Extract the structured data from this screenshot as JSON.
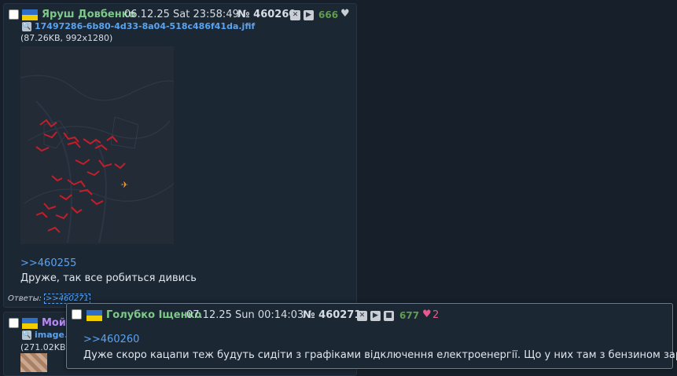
{
  "post1": {
    "name": "Яруш Довбенко",
    "datetime": "06.12.25 Sat 23:58:49",
    "number": "№ 460260",
    "count": "666",
    "file_name": "17497286-6b80-4d33-8a04-518c486f41da.jfif",
    "file_info": "(87.26KB, 992x1280)",
    "reply_ref": ">>460255",
    "text": "Друже, так все робиться дивись",
    "answers_label": "Ответы:",
    "answers_link": ">>460271"
  },
  "post2": {
    "name": "Мойс",
    "file_name": "image.p",
    "file_info": "(271.02KB,"
  },
  "popup": {
    "name": "Голубко Іщенко",
    "datetime": "07.12.25 Sun 00:14:03",
    "number": "№ 460271",
    "count": "677",
    "likes": "2",
    "reply_ref": ">>460260",
    "text": "Дуже скоро кацапи теж будуть сидіти з графіками відключення електроенергії. Що у них там з бензином зараз?"
  },
  "icons": {
    "close": "close-icon",
    "play": "play-icon",
    "stop": "stop-icon",
    "heart": "heart-icon",
    "search": "search-icon",
    "flag": "ukraine-flag-icon"
  },
  "colors": {
    "background": "#17202a",
    "post_bg": "#1c2734",
    "name_green": "#7ec88a",
    "link_blue": "#5aa3f0",
    "like_pink": "#e85a8f"
  }
}
